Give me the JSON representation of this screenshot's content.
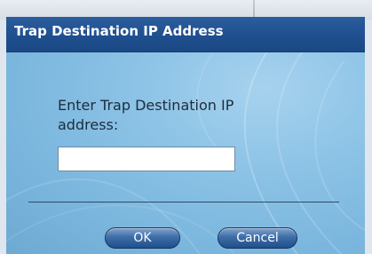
{
  "dialog": {
    "title": "Trap Destination IP Address",
    "prompt": "Enter Trap Destination IP address:",
    "ip_input": {
      "value": "",
      "placeholder": ""
    },
    "buttons": {
      "ok_label": "OK",
      "cancel_label": "Cancel"
    }
  },
  "colors": {
    "titlebar": "#1f4f8f",
    "body": "#7fb8dd",
    "button": "#2f5f9a"
  }
}
